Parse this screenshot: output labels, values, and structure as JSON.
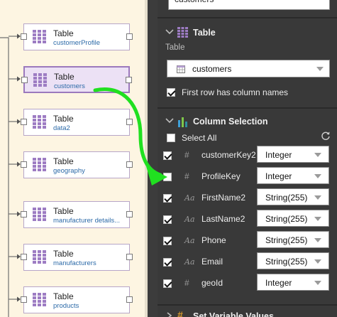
{
  "canvas": {
    "nodes": [
      {
        "type": "Table",
        "name": "customerProfile"
      },
      {
        "type": "Table",
        "name": "customers",
        "selected": true
      },
      {
        "type": "Table",
        "name": "data2"
      },
      {
        "type": "Table",
        "name": "geography"
      },
      {
        "type": "Table",
        "name": "manufacturer details..."
      },
      {
        "type": "Table",
        "name": "manufacturers"
      },
      {
        "type": "Table",
        "name": "products"
      }
    ]
  },
  "panel": {
    "top_field_value": "customers",
    "table_section": {
      "title": "Table",
      "icon": "table-grid-icon",
      "table_label": "Table",
      "table_select_value": "customers",
      "first_row_label": "First row has column names",
      "first_row_checked": true
    },
    "column_section": {
      "title": "Column Selection",
      "icon": "column-selection-icon",
      "select_all_label": "Select All",
      "select_all_checked": false,
      "columns": [
        {
          "name": "customerKey2",
          "type_glyph": "#",
          "type": "Integer",
          "checked": true
        },
        {
          "name": "ProfileKey",
          "type_glyph": "#",
          "type": "Integer",
          "checked": false
        },
        {
          "name": "FirstName2",
          "type_glyph": "Aa",
          "type": "String(255)",
          "checked": true
        },
        {
          "name": "LastName2",
          "type_glyph": "Aa",
          "type": "String(255)",
          "checked": true
        },
        {
          "name": "Phone",
          "type_glyph": "Aa",
          "type": "String(255)",
          "checked": true
        },
        {
          "name": "Email",
          "type_glyph": "Aa",
          "type": "String(255)",
          "checked": true
        },
        {
          "name": "geoId",
          "type_glyph": "#",
          "type": "Integer",
          "checked": true
        }
      ]
    },
    "next_section": {
      "title": "Set Variable Values"
    }
  },
  "colors": {
    "canvas_bg": "#fdf5e2",
    "panel_bg": "#393939",
    "node_border": "#b7a6c8",
    "node_selected_bg": "#ece1f5",
    "node_icon": "#9d7cc3",
    "link_text": "#2c6aa8",
    "annotation_arrow": "#20e020"
  }
}
